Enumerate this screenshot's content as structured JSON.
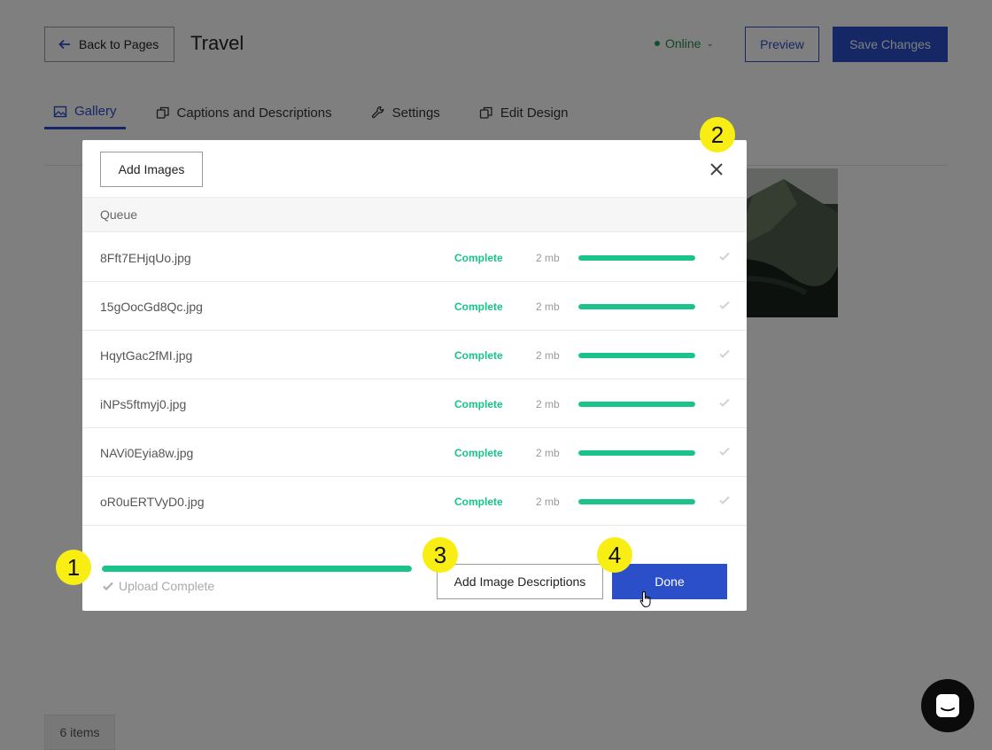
{
  "header": {
    "back_label": "Back to Pages",
    "page_title": "Travel",
    "status_label": "Online",
    "preview_label": "Preview",
    "save_label": "Save Changes"
  },
  "tabs": [
    {
      "label": "Gallery",
      "icon": "image-icon",
      "active": true
    },
    {
      "label": "Captions and Descriptions",
      "icon": "copy-icon",
      "active": false
    },
    {
      "label": "Settings",
      "icon": "wrench-icon",
      "active": false
    },
    {
      "label": "Edit Design",
      "icon": "copy-icon",
      "active": false
    }
  ],
  "items_count": "6 items",
  "modal": {
    "add_images_label": "Add Images",
    "queue_label": "Queue",
    "files": [
      {
        "name": "8Fft7EHjqUo.jpg",
        "status": "Complete",
        "size": "2 mb",
        "progress": 1.0
      },
      {
        "name": "15gOocGd8Qc.jpg",
        "status": "Complete",
        "size": "2 mb",
        "progress": 1.0
      },
      {
        "name": "HqytGac2fMI.jpg",
        "status": "Complete",
        "size": "2 mb",
        "progress": 1.0
      },
      {
        "name": "iNPs5ftmyj0.jpg",
        "status": "Complete",
        "size": "2 mb",
        "progress": 1.0
      },
      {
        "name": "NAVi0Eyia8w.jpg",
        "status": "Complete",
        "size": "2 mb",
        "progress": 1.0
      },
      {
        "name": "oR0uERTVyD0.jpg",
        "status": "Complete",
        "size": "2 mb",
        "progress": 1.0
      }
    ],
    "overall_progress": 1.0,
    "upload_complete_label": "Upload Complete",
    "add_descriptions_label": "Add Image Descriptions",
    "done_label": "Done"
  },
  "callouts": [
    "1",
    "2",
    "3",
    "4"
  ],
  "colors": {
    "accent": "#2b4ec9",
    "success": "#19c38a",
    "callout": "#f8ee14"
  }
}
